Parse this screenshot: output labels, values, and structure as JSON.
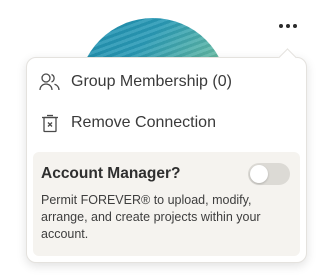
{
  "menu": {
    "items": [
      {
        "label": "Group Membership (0)",
        "icon": "people-icon"
      },
      {
        "label": "Remove Connection",
        "icon": "trash-icon"
      }
    ]
  },
  "account_manager": {
    "title": "Account Manager?",
    "description": "Permit FOREVER® to upload, modify, arrange, and create projects within your account.",
    "toggle_on": false
  },
  "colors": {
    "panel_bg": "#f5f3ef",
    "toggle_off": "#dcdad5",
    "text": "#3a3a3a"
  }
}
